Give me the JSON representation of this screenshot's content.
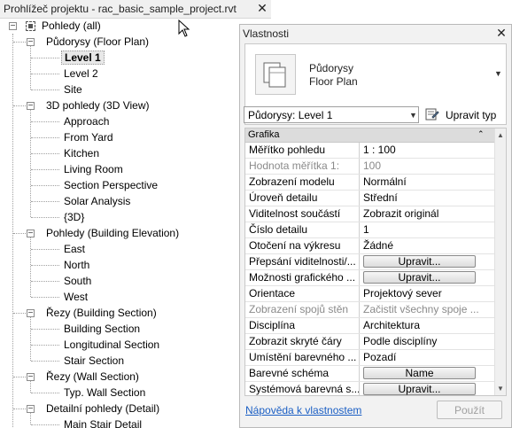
{
  "project_browser": {
    "title": "Prohlížeč projektu - rac_basic_sample_project.rvt",
    "close_glyph": "✕",
    "tree": [
      {
        "label": "Pohledy (all)",
        "icon": "view-root-icon",
        "expander": "−"
      },
      {
        "label": "Půdorysy (Floor Plan)",
        "expander": "−"
      },
      {
        "label": "Level 1",
        "selected": true
      },
      {
        "label": "Level 2"
      },
      {
        "label": "Site"
      },
      {
        "label": "3D pohledy (3D View)",
        "expander": "−"
      },
      {
        "label": "Approach"
      },
      {
        "label": "From Yard"
      },
      {
        "label": "Kitchen"
      },
      {
        "label": "Living Room"
      },
      {
        "label": "Section Perspective"
      },
      {
        "label": "Solar Analysis"
      },
      {
        "label": "{3D}"
      },
      {
        "label": "Pohledy (Building Elevation)",
        "expander": "−"
      },
      {
        "label": "East"
      },
      {
        "label": "North"
      },
      {
        "label": "South"
      },
      {
        "label": "West"
      },
      {
        "label": "Řezy (Building Section)",
        "expander": "−"
      },
      {
        "label": "Building Section"
      },
      {
        "label": "Longitudinal Section"
      },
      {
        "label": "Stair Section"
      },
      {
        "label": "Řezy (Wall Section)",
        "expander": "−"
      },
      {
        "label": "Typ. Wall Section"
      },
      {
        "label": "Detailní pohledy (Detail)",
        "expander": "−"
      },
      {
        "label": "Main Stair Detail"
      }
    ]
  },
  "properties": {
    "title": "Vlastnosti",
    "close_glyph": "✕",
    "type_selector": {
      "family": "Půdorysy",
      "type": "Floor Plan",
      "arrow": "▼",
      "icon": "floor-plan-icon"
    },
    "instance_filter": {
      "value": "Půdorysy: Level 1",
      "arrow": "▼"
    },
    "edit_type_label": "Upravit typ",
    "group": {
      "name": "Grafika",
      "collapse_glyph": "⌃"
    },
    "rows": [
      {
        "name": "Měřítko pohledu",
        "value": "1 : 100"
      },
      {
        "name": "Hodnota měřítka   1:",
        "value": "100",
        "readonly": true
      },
      {
        "name": "Zobrazení modelu",
        "value": "Normální"
      },
      {
        "name": "Úroveň detailu",
        "value": "Střední"
      },
      {
        "name": "Viditelnost součástí",
        "value": "Zobrazit originál"
      },
      {
        "name": "Číslo detailu",
        "value": "1"
      },
      {
        "name": "Otočení na výkresu",
        "value": "Žádné"
      },
      {
        "name": "Přepsání viditelnosti/...",
        "button": "Upravit..."
      },
      {
        "name": "Možnosti grafického ...",
        "button": "Upravit..."
      },
      {
        "name": "Orientace",
        "value": "Projektový sever"
      },
      {
        "name": "Zobrazení spojů stěn",
        "value": "Začistit všechny spoje ...",
        "readonly": true
      },
      {
        "name": "Disciplína",
        "value": "Architektura"
      },
      {
        "name": "Zobrazit skryté čáry",
        "value": "Podle disciplíny"
      },
      {
        "name": "Umístění barevného ...",
        "value": "Pozadí"
      },
      {
        "name": "Barevné schéma",
        "button": "Name"
      },
      {
        "name": "Systémová barevná s...",
        "button": "Upravit..."
      }
    ],
    "scroll_up": "▲",
    "scroll_down": "▼",
    "help_link": "Nápověda k vlastnostem",
    "apply_label": "Použít"
  }
}
